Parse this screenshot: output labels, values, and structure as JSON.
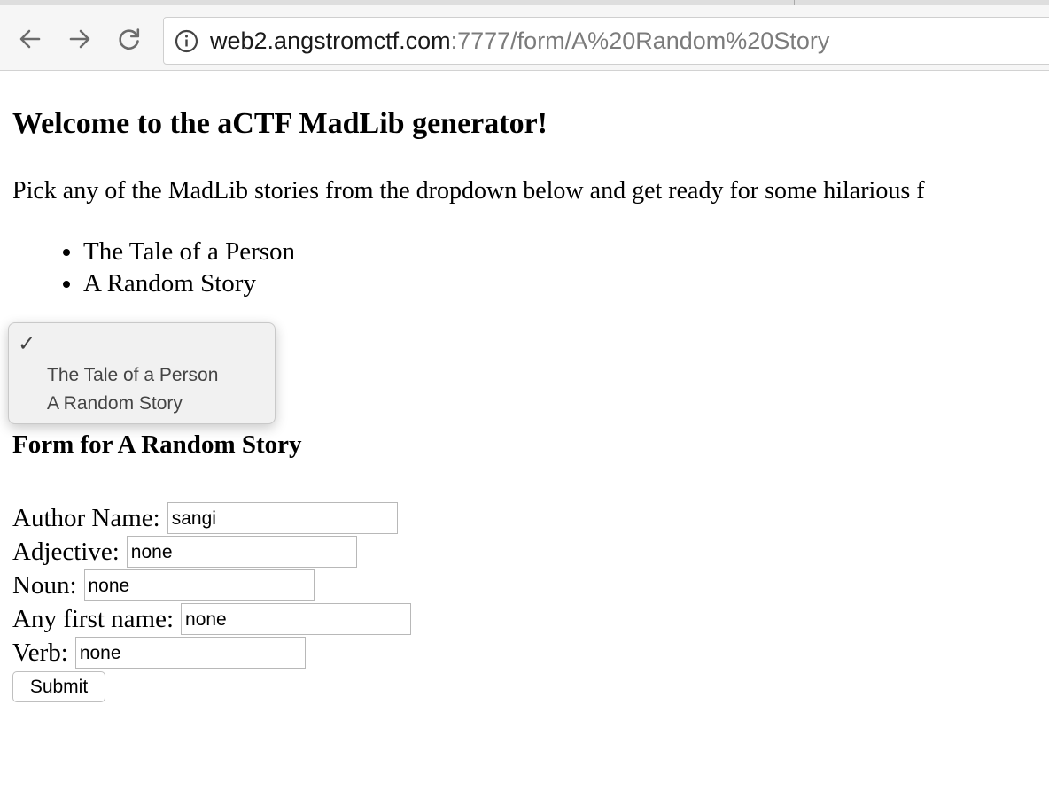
{
  "browser": {
    "url_host": "web2.angstromctf.com",
    "url_rest": ":7777/form/A%20Random%20Story"
  },
  "page": {
    "title": "Welcome to the aCTF MadLib generator!",
    "intro": "Pick any of the MadLib stories from the dropdown below and get ready for some hilarious f",
    "stories": [
      "The Tale of a Person",
      "A Random Story"
    ]
  },
  "dropdown": {
    "checkmark": "✓",
    "options": [
      "The Tale of a Person",
      "A Random Story"
    ]
  },
  "form": {
    "title": "Form for A Random Story",
    "fields": [
      {
        "label": "Author Name:",
        "value": "sangi"
      },
      {
        "label": "Adjective:",
        "value": "none"
      },
      {
        "label": "Noun:",
        "value": "none"
      },
      {
        "label": "Any first name:",
        "value": "none"
      },
      {
        "label": "Verb:",
        "value": "none"
      }
    ],
    "submit_label": "Submit"
  }
}
